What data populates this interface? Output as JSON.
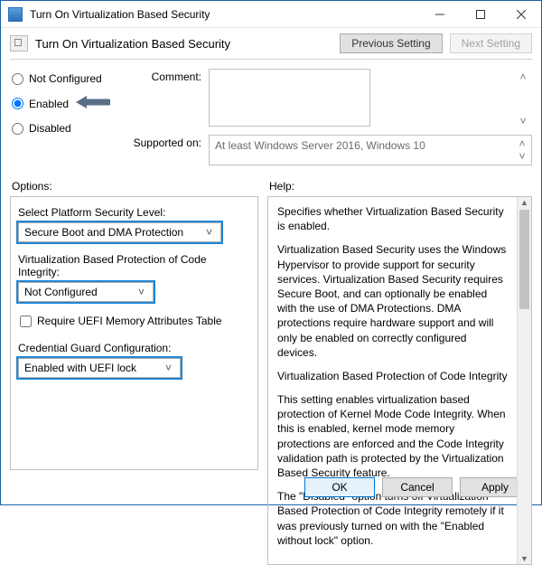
{
  "window": {
    "title": "Turn On Virtualization Based Security",
    "subtitle": "Turn On Virtualization Based Security"
  },
  "nav": {
    "prev": "Previous Setting",
    "next": "Next Setting"
  },
  "state_radios": {
    "not_configured": "Not Configured",
    "enabled": "Enabled",
    "disabled": "Disabled",
    "selected": "enabled"
  },
  "labels": {
    "comment": "Comment:",
    "supported_on": "Supported on:",
    "options": "Options:",
    "help": "Help:"
  },
  "supported_on_value": "At least Windows Server 2016, Windows 10",
  "options": {
    "platform_label": "Select Platform Security Level:",
    "platform_value": "Secure Boot and DMA Protection",
    "vbci_label": "Virtualization Based Protection of Code Integrity:",
    "vbci_value": "Not Configured",
    "uefi_checkbox": "Require UEFI Memory Attributes Table",
    "credguard_label": "Credential Guard Configuration:",
    "credguard_value": "Enabled with UEFI lock"
  },
  "help_paragraphs": {
    "p1": "Specifies whether Virtualization Based Security is enabled.",
    "p2": "Virtualization Based Security uses the Windows Hypervisor to provide support for security services. Virtualization Based Security requires Secure Boot, and can optionally be enabled with the use of DMA Protections. DMA protections require hardware support and will only be enabled on correctly configured devices.",
    "p3": "Virtualization Based Protection of Code Integrity",
    "p4": "This setting enables virtualization based protection of Kernel Mode Code Integrity. When this is enabled, kernel mode memory protections are enforced and the Code Integrity validation path is protected by the Virtualization Based Security feature.",
    "p5": "The \"Disabled\" option turns off Virtualization Based Protection of Code Integrity remotely if it was previously turned on with the \"Enabled without lock\" option."
  },
  "footer": {
    "ok": "OK",
    "cancel": "Cancel",
    "apply": "Apply"
  }
}
